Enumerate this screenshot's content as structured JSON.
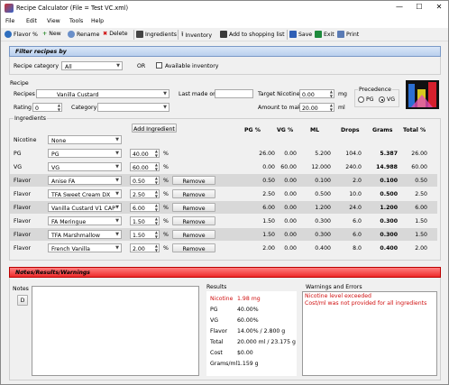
{
  "window": {
    "title": "Recipe Calculator (File = Test VC.xml)",
    "min": "—",
    "max": "☐",
    "close": "✕"
  },
  "menu": [
    "File",
    "Edit",
    "View",
    "Tools",
    "Help"
  ],
  "toolbar": {
    "flavor": "Flavor %",
    "new": "New",
    "rename": "Rename",
    "delete": "Delete",
    "ingredients": "Ingredients",
    "inventory": "Inventory",
    "add_shopping": "Add to shopping list",
    "save": "Save",
    "exit": "Exit",
    "print": "Print"
  },
  "filter": {
    "header": "Filter recipes by",
    "category_label": "Recipe category",
    "category_value": "All",
    "or": "OR",
    "available": "Available inventory"
  },
  "recipe": {
    "section": "Recipe",
    "recipes_label": "Recipes",
    "recipe_value": "Vanilla Custard",
    "last_made_label": "Last made on",
    "last_made_value": "",
    "target_nic_label": "Target Nicotine",
    "target_nic_value": "0.00",
    "target_nic_unit": "mg",
    "rating_label": "Rating",
    "rating_value": "0",
    "category_label": "Category",
    "category_value": "",
    "amount_label": "Amount to make",
    "amount_value": "20.00",
    "amount_unit": "ml",
    "precedence_label": "Precedence",
    "pg": "PG",
    "vg": "VG"
  },
  "ingredients": {
    "section": "Ingredients",
    "add_button": "Add Ingredient",
    "remove": "Remove",
    "pct": "%",
    "headers": [
      "PG %",
      "VG %",
      "ML",
      "Drops",
      "Grams",
      "Total %"
    ],
    "rows": [
      {
        "type": "Nicotine",
        "name": "None",
        "pct": "",
        "pg": "",
        "vg": "",
        "ml": "",
        "drops": "",
        "grams": "",
        "total": "",
        "remove": false,
        "shade": false
      },
      {
        "type": "PG",
        "name": "PG",
        "pct": "40.00",
        "pg": "26.00",
        "vg": "0.00",
        "ml": "5.200",
        "drops": "104.0",
        "grams": "5.387",
        "total": "26.00",
        "remove": false,
        "shade": false
      },
      {
        "type": "VG",
        "name": "VG",
        "pct": "60.00",
        "pg": "0.00",
        "vg": "60.00",
        "ml": "12.000",
        "drops": "240.0",
        "grams": "14.988",
        "total": "60.00",
        "remove": false,
        "shade": false
      },
      {
        "type": "Flavor",
        "name": "Anise FA",
        "pct": "0.50",
        "pg": "0.50",
        "vg": "0.00",
        "ml": "0.100",
        "drops": "2.0",
        "grams": "0.100",
        "total": "0.50",
        "remove": true,
        "shade": true
      },
      {
        "type": "Flavor",
        "name": "TFA Sweet Cream DX",
        "pct": "2.50",
        "pg": "2.50",
        "vg": "0.00",
        "ml": "0.500",
        "drops": "10.0",
        "grams": "0.500",
        "total": "2.50",
        "remove": true,
        "shade": false
      },
      {
        "type": "Flavor",
        "name": "Vanilla Custard V1 CAP",
        "pct": "6.00",
        "pg": "6.00",
        "vg": "0.00",
        "ml": "1.200",
        "drops": "24.0",
        "grams": "1.200",
        "total": "6.00",
        "remove": true,
        "shade": true
      },
      {
        "type": "Flavor",
        "name": "FA Meringue",
        "pct": "1.50",
        "pg": "1.50",
        "vg": "0.00",
        "ml": "0.300",
        "drops": "6.0",
        "grams": "0.300",
        "total": "1.50",
        "remove": true,
        "shade": false
      },
      {
        "type": "Flavor",
        "name": "TFA Marshmallow",
        "pct": "1.50",
        "pg": "1.50",
        "vg": "0.00",
        "ml": "0.300",
        "drops": "6.0",
        "grams": "0.300",
        "total": "1.50",
        "remove": true,
        "shade": true
      },
      {
        "type": "Flavor",
        "name": "French Vanilla",
        "pct": "2.00",
        "pg": "2.00",
        "vg": "0.00",
        "ml": "0.400",
        "drops": "8.0",
        "grams": "0.400",
        "total": "2.00",
        "remove": true,
        "shade": false
      }
    ]
  },
  "results_panel": {
    "header": "Notes/Results/Warnings",
    "notes_label": "Notes",
    "notes_btn": "D",
    "results_label": "Results",
    "warnings_label": "Warnings and Errors",
    "results": [
      {
        "k": "Nicotine",
        "v": "1.98 mg",
        "red": true
      },
      {
        "k": "PG",
        "v": "40.00%",
        "red": false
      },
      {
        "k": "VG",
        "v": "60.00%",
        "red": false
      },
      {
        "k": "Flavor",
        "v": "14.00% / 2.800 g",
        "red": false
      },
      {
        "k": "Total",
        "v": "20.000 ml / 23.175 g",
        "red": false
      },
      {
        "k": "Cost",
        "v": "$0.00",
        "red": false
      },
      {
        "k": "Grams/ml",
        "v": "1.159 g",
        "red": false
      }
    ],
    "warnings": [
      "Nicotine level exceeded",
      "Cost/ml was not provided for all ingredients"
    ]
  },
  "colors": {
    "accent": "#b9cfee",
    "warn": "#ee2a2a",
    "shade": "#d8d8d8"
  }
}
